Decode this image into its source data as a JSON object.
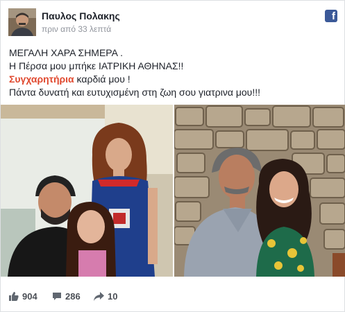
{
  "post": {
    "author": "Παυλος Πολακης",
    "time": "πριν από 33 λεπτά",
    "lines": {
      "l1": "ΜΕΓΑΛΗ ΧΑΡΑ ΣΗΜΕΡΑ .",
      "l2": "Η Πέρσα μου μπήκε ΙΑΤΡΙΚΗ ΑΘΗΝΑΣ!!",
      "l3_em": "Συγχαρητήρια",
      "l3_rest": " καρδιά μου !",
      "l4": "Πάντα δυνατή και ευτυχισμένη στη ζωη σου γιατρινα μου!!!"
    }
  },
  "social": {
    "fb_letter": "f"
  },
  "stats": {
    "likes": "904",
    "comments": "286",
    "shares": "10"
  },
  "colors": {
    "facebook_blue": "#3b5998",
    "highlight_red": "#e0492f",
    "meta_gray": "#90949c"
  },
  "icons": [
    "facebook-logo-icon",
    "like-icon",
    "comment-icon",
    "share-icon"
  ]
}
